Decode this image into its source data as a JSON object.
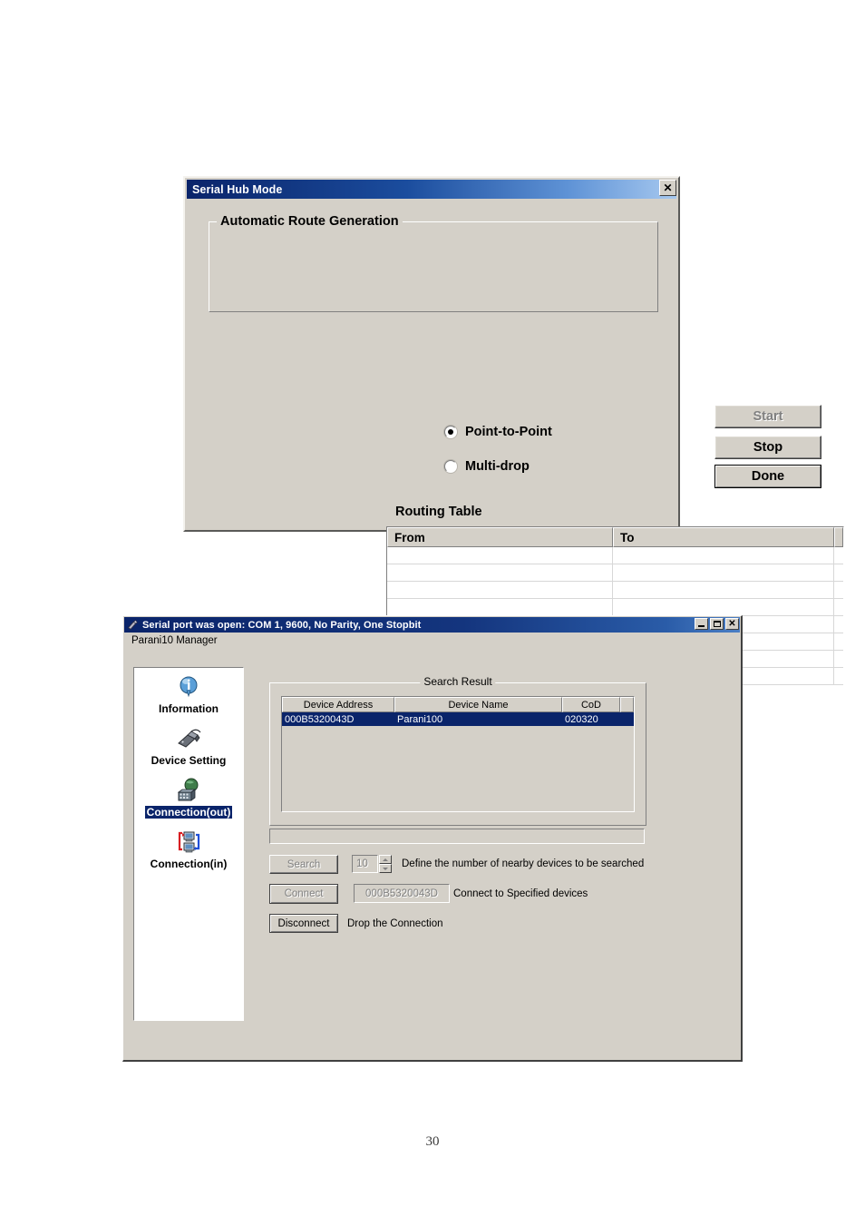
{
  "page": {
    "number": "30"
  },
  "hub_dialog": {
    "title": "Serial Hub Mode",
    "close_icon": "close-icon",
    "close_label": "✕",
    "group_legend": "Automatic Route Generation",
    "radios": [
      {
        "label": "Point-to-Point",
        "checked": true
      },
      {
        "label": "Multi-drop",
        "checked": false
      }
    ],
    "buttons": {
      "start": "Start",
      "stop": "Stop",
      "done": "Done"
    },
    "routing": {
      "label": "Routing Table",
      "columns": [
        "From",
        "To"
      ],
      "rows": [],
      "empty_row_count": 8
    }
  },
  "manager_window": {
    "title": "Serial port was open: COM 1, 9600, No Parity, One Stopbit",
    "app_icon": "serial-port-icon",
    "window_controls": [
      {
        "name": "minimize-button",
        "glyph": "_"
      },
      {
        "name": "maximize-button",
        "glyph": "□"
      },
      {
        "name": "close-button",
        "glyph": "✕"
      }
    ],
    "menu": {
      "item": "Parani10 Manager"
    },
    "sidebar": {
      "items": [
        {
          "label": "Information",
          "icon": "information-icon",
          "selected": false
        },
        {
          "label": "Device Setting",
          "icon": "device-setting-icon",
          "selected": false
        },
        {
          "label": "Connection(out)",
          "icon": "connection-out-icon",
          "selected": true
        },
        {
          "label": "Connection(in)",
          "icon": "connection-in-icon",
          "selected": false
        }
      ]
    },
    "search_result": {
      "legend": "Search Result",
      "columns": [
        "Device Address",
        "Device Name",
        "CoD"
      ],
      "rows": [
        {
          "address": "000B5320043D",
          "name": "Parani100",
          "cod": "020320",
          "selected": true
        }
      ]
    },
    "progress": {
      "value": ""
    },
    "controls": {
      "search_button": "Search",
      "search_button_disabled": true,
      "search_count_value": "10",
      "search_hint": "Define the number of nearby devices to be searched",
      "connect_button": "Connect",
      "connect_button_disabled": true,
      "connect_address_value": "000B5320043D",
      "connect_hint": "Connect to Specified devices",
      "disconnect_button": "Disconnect",
      "disconnect_hint": "Drop the Connection"
    }
  },
  "colors": {
    "titlebar_blue": "#0a246a",
    "selection_blue": "#0a246a",
    "face": "#d4d0c8"
  }
}
